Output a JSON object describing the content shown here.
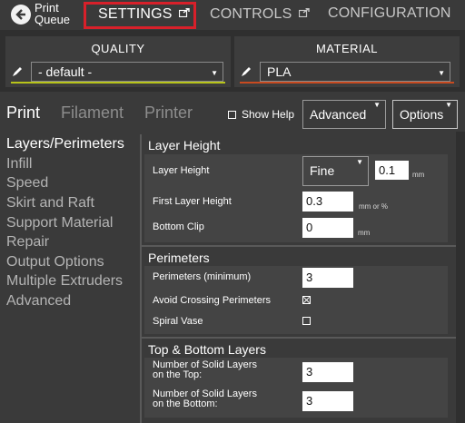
{
  "topbar": {
    "print_queue_label": "Print Queue",
    "tabs": [
      {
        "label": "SETTINGS",
        "active": true
      },
      {
        "label": "CONTROLS",
        "active": false
      },
      {
        "label": "CONFIGURATION",
        "active": false
      }
    ],
    "highlight_color": "#d8202a"
  },
  "presets": {
    "quality": {
      "title": "QUALITY",
      "value": "- default -",
      "accent": "#b8c41a"
    },
    "material": {
      "title": "MATERIAL",
      "value": "PLA",
      "accent": "#c84a20"
    }
  },
  "subtabs": [
    {
      "label": "Print",
      "active": true
    },
    {
      "label": "Filament",
      "active": false
    },
    {
      "label": "Printer",
      "active": false
    }
  ],
  "toolbar": {
    "show_help_label": "Show Help",
    "show_help_checked": false,
    "mode_value": "Advanced",
    "options_label": "Options"
  },
  "leftnav": {
    "items": [
      {
        "label": "Layers/Perimeters",
        "active": true
      },
      {
        "label": "Infill",
        "active": false
      },
      {
        "label": "Speed",
        "active": false
      },
      {
        "label": "Skirt and Raft",
        "active": false
      },
      {
        "label": "Support Material",
        "active": false
      },
      {
        "label": "Repair",
        "active": false
      },
      {
        "label": "Output Options",
        "active": false
      },
      {
        "label": "Multiple Extruders",
        "active": false
      },
      {
        "label": "Advanced",
        "active": false
      }
    ]
  },
  "layer_height": {
    "title": "Layer Height",
    "layer_height_label": "Layer Height",
    "layer_height_preset": "Fine",
    "layer_height_value": "0.1",
    "layer_height_unit": "mm",
    "first_layer_label": "First Layer Height",
    "first_layer_value": "0.3",
    "first_layer_unit": "mm or %",
    "bottom_clip_label": "Bottom Clip",
    "bottom_clip_value": "0",
    "bottom_clip_unit": "mm"
  },
  "perimeters": {
    "title": "Perimeters",
    "min_label": "Perimeters (minimum)",
    "min_value": "3",
    "avoid_label": "Avoid Crossing Perimeters",
    "avoid_checked": true,
    "spiral_label": "Spiral Vase",
    "spiral_checked": false
  },
  "top_bottom": {
    "title": "Top & Bottom Layers",
    "top_label_1": "Number of Solid Layers",
    "top_label_2": "on the Top:",
    "top_value": "3",
    "bottom_label_1": "Number of Solid Layers",
    "bottom_label_2": "on the Bottom:",
    "bottom_value": "3"
  }
}
